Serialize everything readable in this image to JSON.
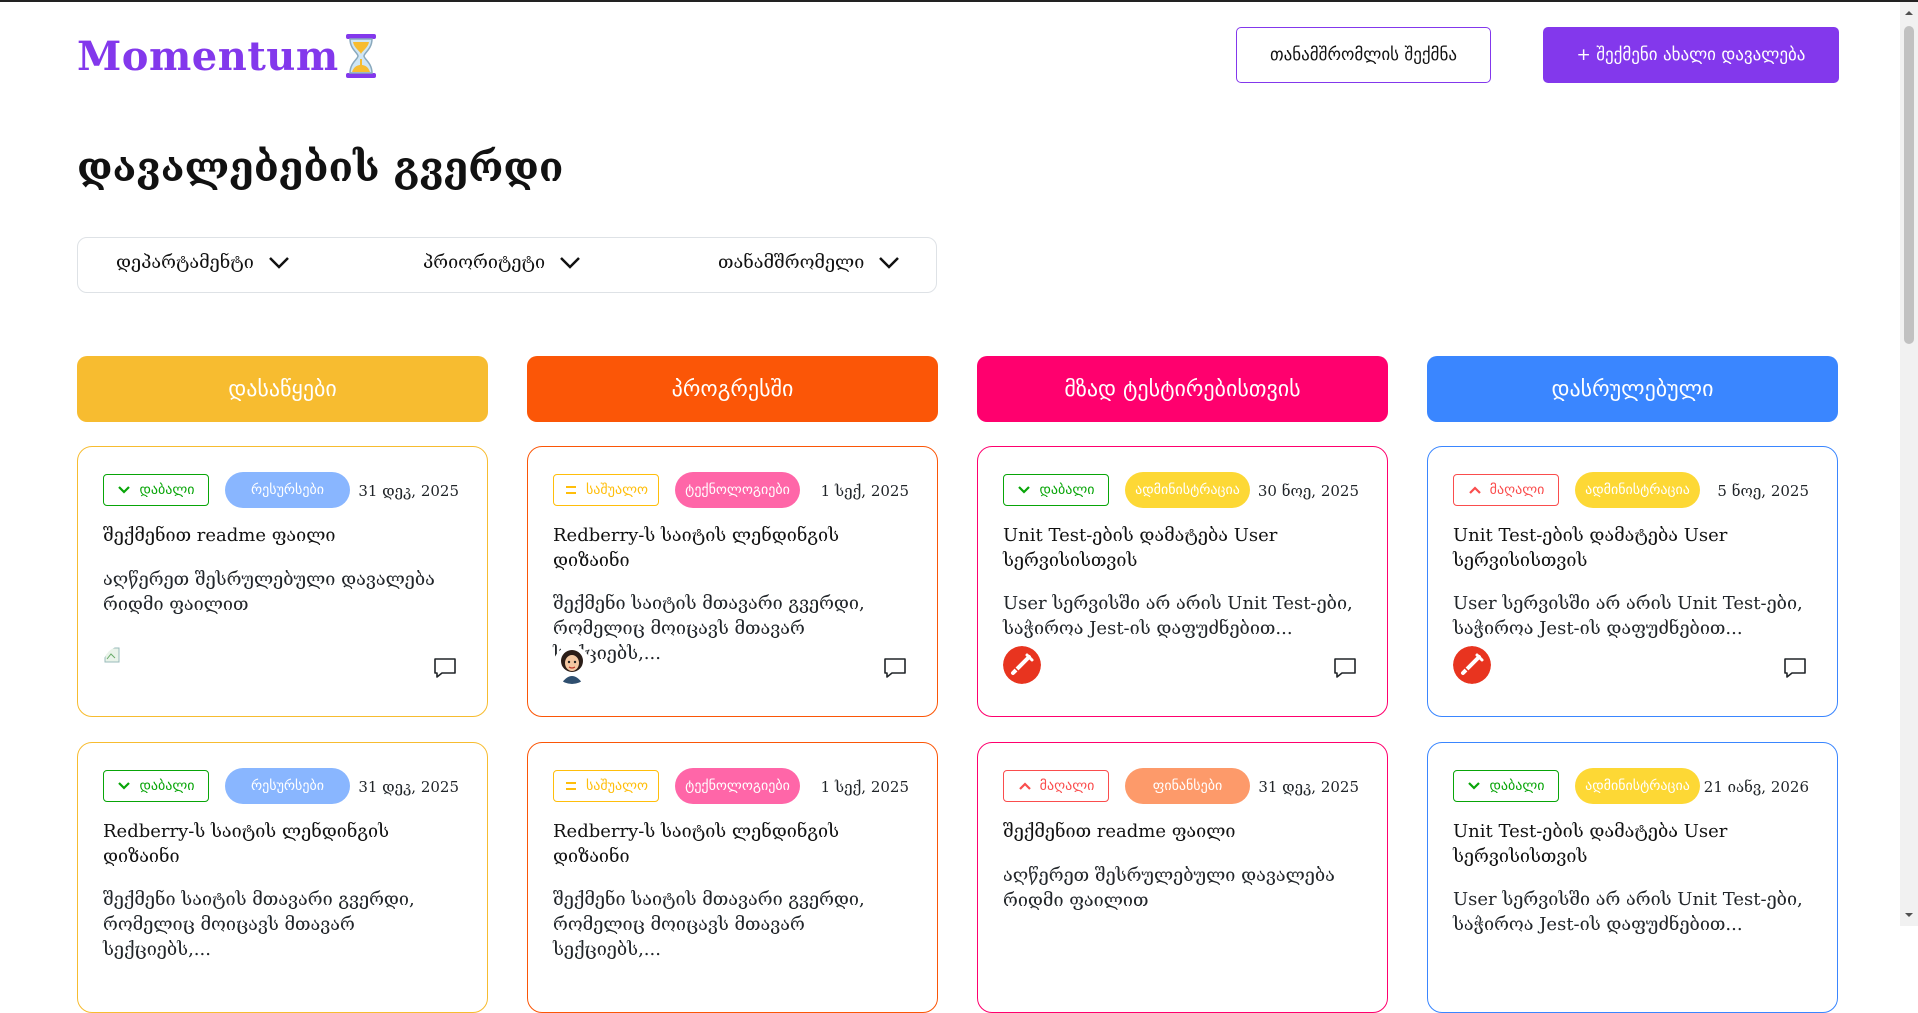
{
  "header": {
    "logo": "Momentum",
    "create_employee": "თანამშრომლის შექმნა",
    "create_task": "+ შექმენი ახალი დავალება"
  },
  "page": {
    "title": "დავალებების გვერდი"
  },
  "filters": [
    {
      "label": "დეპარტამენტი"
    },
    {
      "label": "პრიორიტეტი"
    },
    {
      "label": "თანამშრომელი"
    }
  ],
  "colors": {
    "accent": "#8338ec",
    "todo": "#f7bc30",
    "progress": "#fb5607",
    "testing": "#ff006e",
    "done": "#3a86ff",
    "low": "#08a508",
    "medium": "#ffbe0b",
    "high": "#fa4d4d"
  },
  "columns": [
    {
      "title": "დასაწყები",
      "color": "#f7bc30",
      "cards": [
        {
          "priority": "დაბალი",
          "priority_level": "low",
          "department": "რესურსები",
          "department_color": "#89b6ff",
          "date": "31 დეკ, 2025",
          "title": "შექმენით readme ფაილი",
          "description": "აღწერეთ შესრულებული დავალება რიდმი ფაილით",
          "avatar": "broken",
          "avatar_alt": "ava"
        },
        {
          "priority": "დაბალი",
          "priority_level": "low",
          "department": "რესურსები",
          "department_color": "#89b6ff",
          "date": "31 დეკ, 2025",
          "title": "Redberry-ს საიტის ლენდინგის დიზაინი",
          "description": "შექმენი საიტის მთავარი გვერდი, რომელიც მოიცავს მთავარ სექციებს,...",
          "avatar": "none"
        }
      ]
    },
    {
      "title": "პროგრესში",
      "color": "#fb5607",
      "cards": [
        {
          "priority": "საშუალო",
          "priority_level": "medium",
          "department": "ტექნოლოგიები",
          "department_color": "#ff66a8",
          "date": "1 სექ, 2025",
          "title": "Redberry-ს საიტის ლენდინგის დიზაინი",
          "description": "შექმენი საიტის მთავარი გვერდი, რომელიც მოიცავს მთავარ სექციებს,...",
          "avatar": "woman"
        },
        {
          "priority": "საშუალო",
          "priority_level": "medium",
          "department": "ტექნოლოგიები",
          "department_color": "#ff66a8",
          "date": "1 სექ, 2025",
          "title": "Redberry-ს საიტის ლენდინგის დიზაინი",
          "description": "შექმენი საიტის მთავარი გვერდი, რომელიც მოიცავს მთავარ სექციებს,...",
          "avatar": "none"
        }
      ]
    },
    {
      "title": "მზად ტესტირებისთვის",
      "color": "#ff006e",
      "cards": [
        {
          "priority": "დაბალი",
          "priority_level": "low",
          "department": "ადმინისტრაცია",
          "department_color": "#fdd835",
          "date": "30 ნოე, 2025",
          "title": "Unit Test-ების დამატება User სერვისისთვის",
          "description": "User სერვისში არ არის Unit Test-ები, საჭიროა Jest-ის დაფუძნებით...",
          "avatar": "red"
        },
        {
          "priority": "მაღალი",
          "priority_level": "high",
          "department": "ფინანსები",
          "department_color": "#fd9a6a",
          "date": "31 დეკ, 2025",
          "title": "შექმენით readme ფაილი",
          "description": "აღწერეთ შესრულებული დავალება რიდმი ფაილით",
          "avatar": "none"
        }
      ]
    },
    {
      "title": "დასრულებული",
      "color": "#3a86ff",
      "cards": [
        {
          "priority": "მაღალი",
          "priority_level": "high",
          "department": "ადმინისტრაცია",
          "department_color": "#fdd835",
          "date": "5 ნოე, 2025",
          "title": "Unit Test-ების დამატება User სერვისისთვის",
          "description": "User სერვისში არ არის Unit Test-ები, საჭიროა Jest-ის დაფუძნებით...",
          "avatar": "red"
        },
        {
          "priority": "დაბალი",
          "priority_level": "low",
          "department": "ადმინისტრაცია",
          "department_color": "#fdd835",
          "date": "21 იანვ, 2026",
          "title": "Unit Test-ების დამატება User სერვისისთვის",
          "description": "User სერვისში არ არის Unit Test-ები, საჭიროა Jest-ის დაფუძნებით...",
          "avatar": "none"
        }
      ]
    }
  ]
}
